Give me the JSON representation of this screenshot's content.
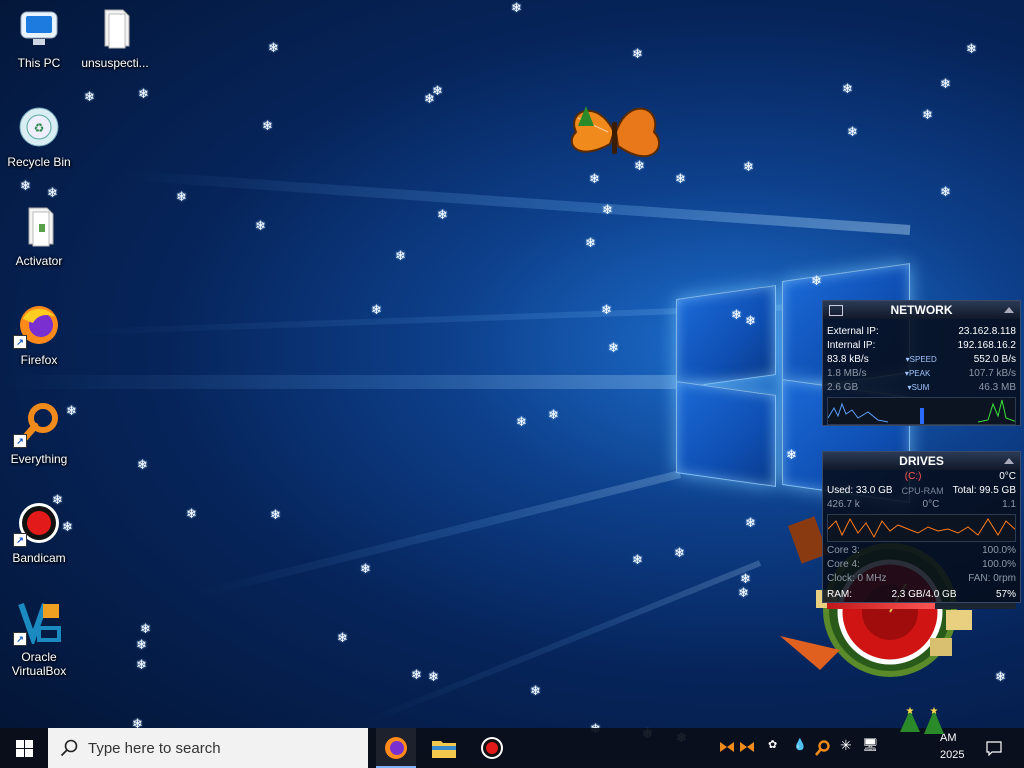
{
  "desktop": {
    "icons": [
      {
        "label": "This PC",
        "icon": "computer-icon"
      },
      {
        "label": "unsuspecti...",
        "icon": "file-icon"
      },
      {
        "label": "Recycle Bin",
        "icon": "recycle-bin-icon"
      },
      {
        "label": "Activator",
        "icon": "file-icon"
      },
      {
        "label": "Firefox",
        "icon": "firefox-icon"
      },
      {
        "label": "Everything",
        "icon": "everything-search-icon"
      },
      {
        "label": "Bandicam",
        "icon": "bandicam-record-icon"
      },
      {
        "label": "Oracle\nVirtualBox",
        "icon": "virtualbox-icon"
      }
    ]
  },
  "network_widget": {
    "title": "NETWORK",
    "external_ip_label": "External IP:",
    "external_ip": "23.162.8.118",
    "internal_ip_label": "Internal IP:",
    "internal_ip": "192.168.16.2",
    "speed_down": "83.8 kB/s",
    "speed_label": "SPEED",
    "speed_up": "552.0 B/s",
    "peak_down": "1.8 MB/s",
    "peak_label": "PEAK",
    "peak_up": "107.7 kB/s",
    "sum_down": "2.6 GB",
    "sum_label": "SUM",
    "sum_up": "46.3 MB"
  },
  "drives_widget": {
    "title": "DRIVES",
    "drive_letter": "(C:)",
    "temp": "0°C",
    "overlay_label": "CPU-RAM",
    "used_label": "Used: 33.0 GB",
    "total_label": "Total: 99.5 GB",
    "read_rate": "426.7 k",
    "read_temp": "0°C",
    "write_rate": "1.1",
    "core3_label": "Core 3:",
    "core3_value": "100.0%",
    "core4_label": "Core 4:",
    "core4_value": "100.0%",
    "clock_label": "Clock: 0 MHz",
    "fan_label": "FAN: 0rpm",
    "ram_label": "RAM:",
    "ram_value": "2.3 GB/4.0 GB",
    "ram_percent": "57%",
    "ram_fraction": 0.57
  },
  "taskbar": {
    "search_placeholder": "Type here to search",
    "apps": [
      {
        "name": "firefox",
        "active": true
      },
      {
        "name": "file-explorer",
        "active": false
      },
      {
        "name": "bandicam",
        "active": false
      }
    ],
    "clock_time": "AM",
    "clock_date": "2025"
  }
}
